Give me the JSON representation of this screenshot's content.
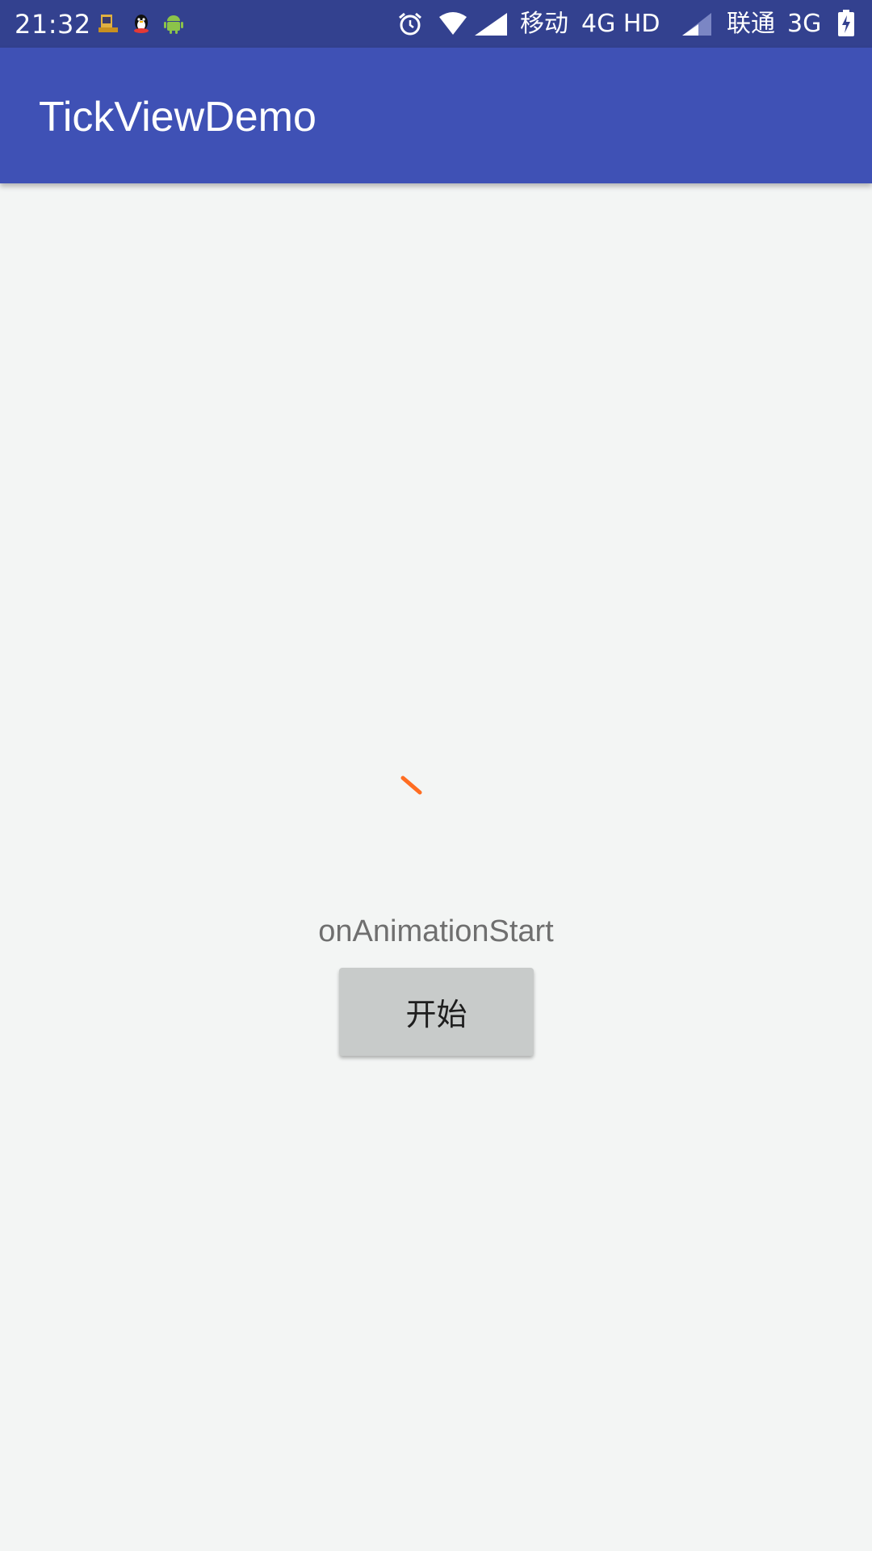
{
  "status_bar": {
    "time": "21:32",
    "carrier1": "移动",
    "network1": "4G HD",
    "carrier2": "联通",
    "network2": "3G",
    "icons": [
      "notification-box-icon",
      "qq-penguin-icon",
      "android-icon",
      "alarm-icon",
      "wifi-icon",
      "signal-icon",
      "battery-icon"
    ]
  },
  "app_bar": {
    "title": "TickViewDemo"
  },
  "main": {
    "status_text": "onAnimationStart",
    "start_button_label": "开始"
  },
  "colors": {
    "status_bar": "#33418f",
    "app_bar": "#3f51b5",
    "tick_stroke": "#ff6d22",
    "button_bg": "#c8cbca"
  }
}
